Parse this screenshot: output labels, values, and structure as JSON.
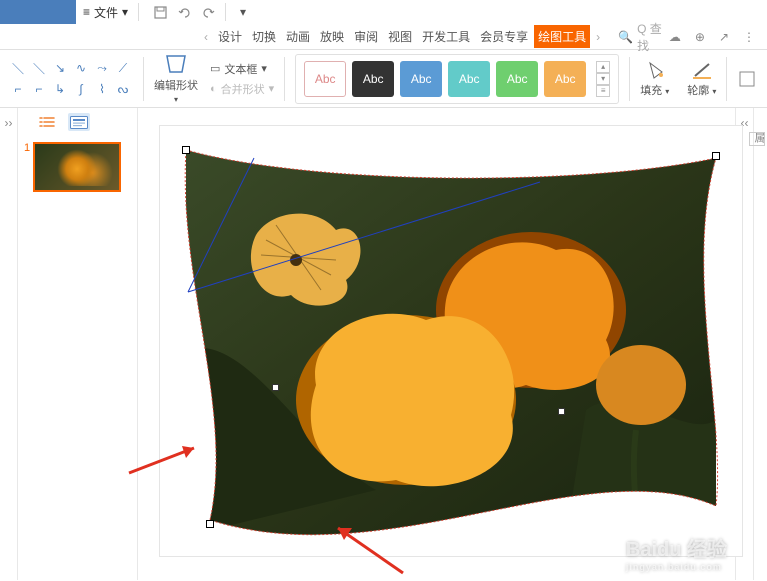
{
  "file_menu": {
    "label": "文件",
    "dropdown_icon": "chevron-down-icon"
  },
  "tabs": {
    "items": [
      "设计",
      "切换",
      "动画",
      "放映",
      "审阅",
      "视图",
      "开发工具",
      "会员专享"
    ],
    "active": "绘图工具",
    "nav_prev": "‹",
    "nav_next": "›"
  },
  "search": {
    "placeholder": "Q 查找"
  },
  "ribbon": {
    "edit_shape": "编辑形状",
    "text_box": "文本框",
    "merge_shapes": "合并形状",
    "style_label": "Abc",
    "fill": "填充",
    "outline": "轮廓"
  },
  "thumbnails": {
    "slide_num": "1"
  },
  "right_panel": {
    "label": "属"
  },
  "watermark": {
    "brand": "Baidu 经验",
    "sub": "jingyan.baidu.com"
  }
}
